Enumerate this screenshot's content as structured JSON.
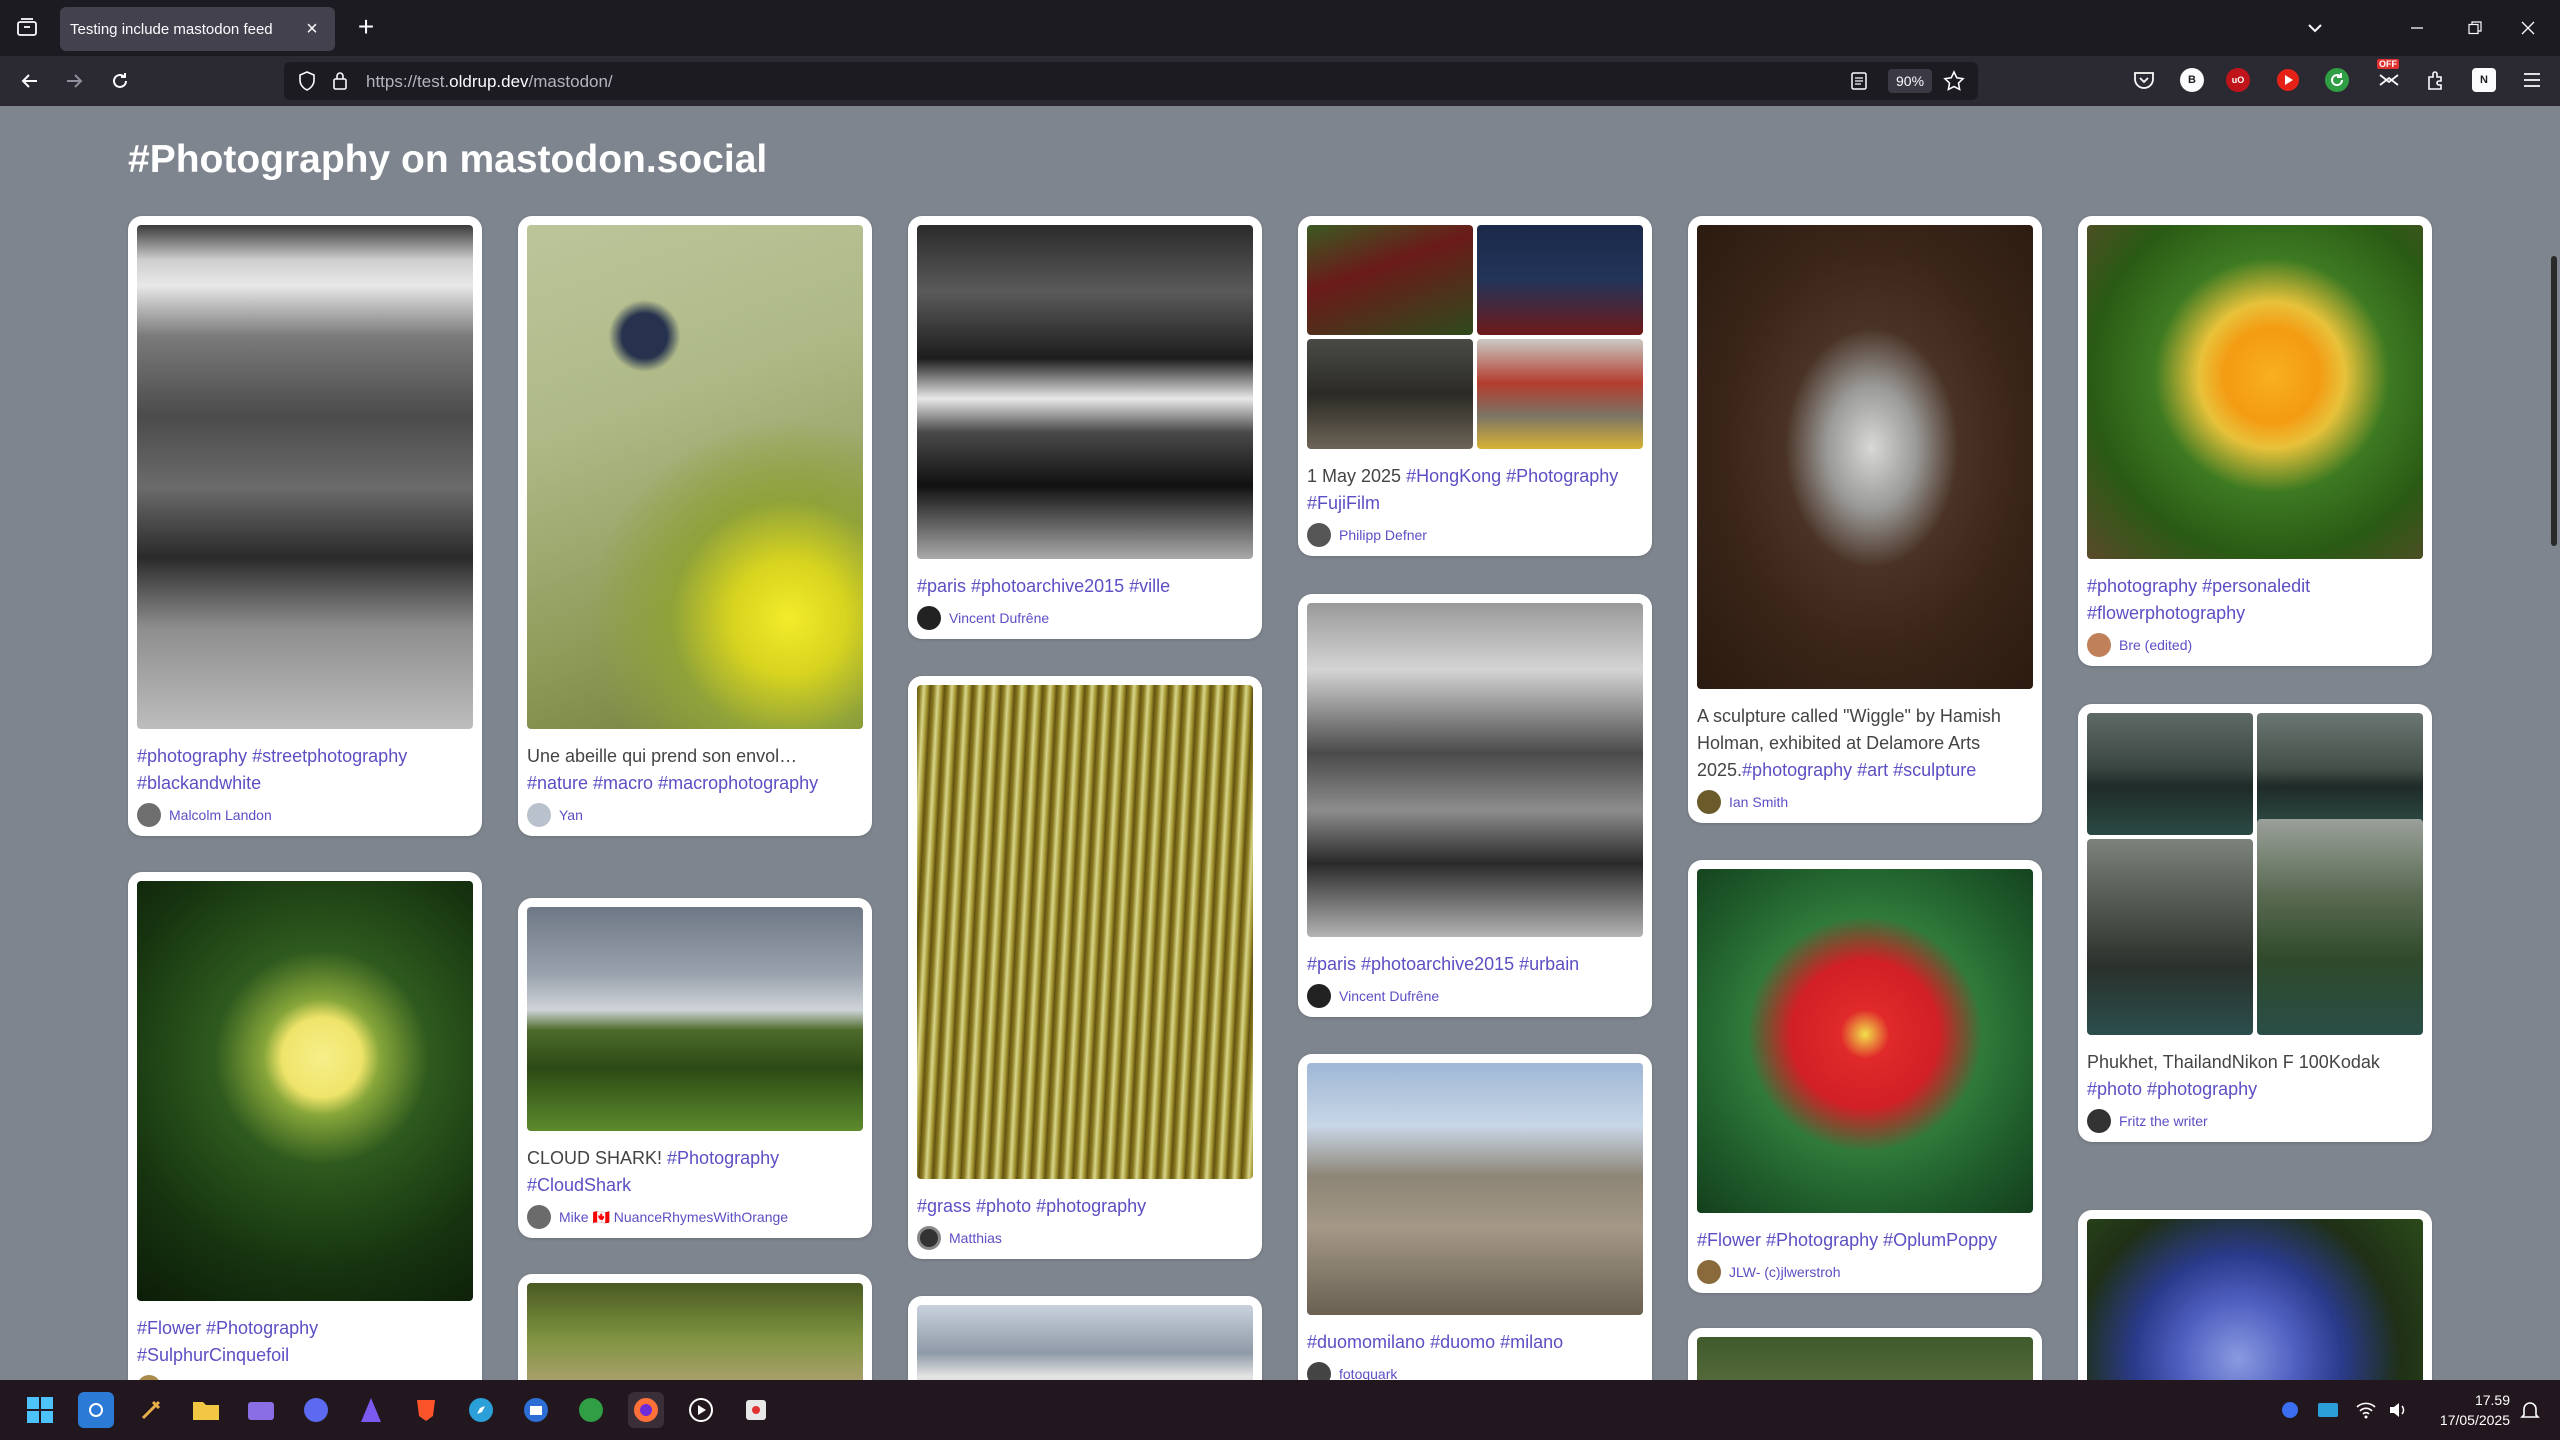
{
  "browser": {
    "tab_title": "Testing include mastodon feed",
    "url_prefix": "https://test.",
    "url_host": "oldrup.dev",
    "url_path": "/mastodon/",
    "zoom": "90%",
    "extensions": [
      {
        "name": "pocket-icon",
        "label": ""
      },
      {
        "name": "b-extension-icon",
        "label": "B"
      },
      {
        "name": "ublock-origin-icon",
        "label": "uO"
      },
      {
        "name": "youtube-icon",
        "label": ""
      },
      {
        "name": "green-sync-icon",
        "label": ""
      },
      {
        "name": "off-extension-icon",
        "label": "OFF"
      },
      {
        "name": "extensions-icon",
        "label": ""
      },
      {
        "name": "n-extension-icon",
        "label": "N"
      }
    ]
  },
  "page": {
    "title": "#Photography on mastodon.social"
  },
  "cards": [
    {
      "caption_text": "",
      "tags": "#photography #streetphotography #blackandwhite",
      "author": "Malcolm Landon"
    },
    {
      "caption_text": "Une abeille qui prend son envol… ",
      "tags": "#nature #macro #macrophotography",
      "author": "Yan"
    },
    {
      "caption_text": "",
      "tags": "#paris #photoarchive2015 #ville",
      "author": "Vincent Dufrêne"
    },
    {
      "caption_text": "1 May 2025 ",
      "tags": "#HongKong #Photography #FujiFilm",
      "author": "Philipp Defner"
    },
    {
      "caption_text": "A sculpture called \"Wiggle\" by Hamish Holman, exhibited at Delamore Arts 2025.",
      "tags": "#photography #art #sculpture",
      "author": "Ian Smith"
    },
    {
      "caption_text": "",
      "tags": "#photography #personaledit #flowerphotography",
      "author": "Bre (edited)"
    },
    {
      "caption_text": "",
      "tags": "#Flower #Photography #SulphurCinquefoil",
      "author": ""
    },
    {
      "caption_text": "CLOUD SHARK! ",
      "tags": "#Photography #CloudShark",
      "author": "Mike 🇨🇦 NuanceRhymesWithOrange"
    },
    {
      "caption_text": "",
      "tags": "#grass #photo #photography",
      "author": "Matthias"
    },
    {
      "caption_text": "",
      "tags": "#paris #photoarchive2015 #urbain",
      "author": "Vincent Dufrêne"
    },
    {
      "caption_text": "",
      "tags": "#Flower #Photography #OplumPoppy",
      "author": "JLW- (c)jlwerstroh"
    },
    {
      "caption_text": "Phukhet, ThailandNikon F 100Kodak ",
      "tags": "#photo #photography",
      "author": "Fritz the writer"
    },
    {
      "caption_text": "",
      "tags": "#duomomilano #duomo #milano",
      "author": "fotoquark"
    }
  ],
  "taskbar": {
    "time": "17.59",
    "date": "17/05/2025"
  },
  "colors": {
    "page_bg": "#7e858e",
    "link": "#5b4fc4",
    "chrome_dark": "#1c1b22",
    "chrome": "#2b2a33"
  }
}
